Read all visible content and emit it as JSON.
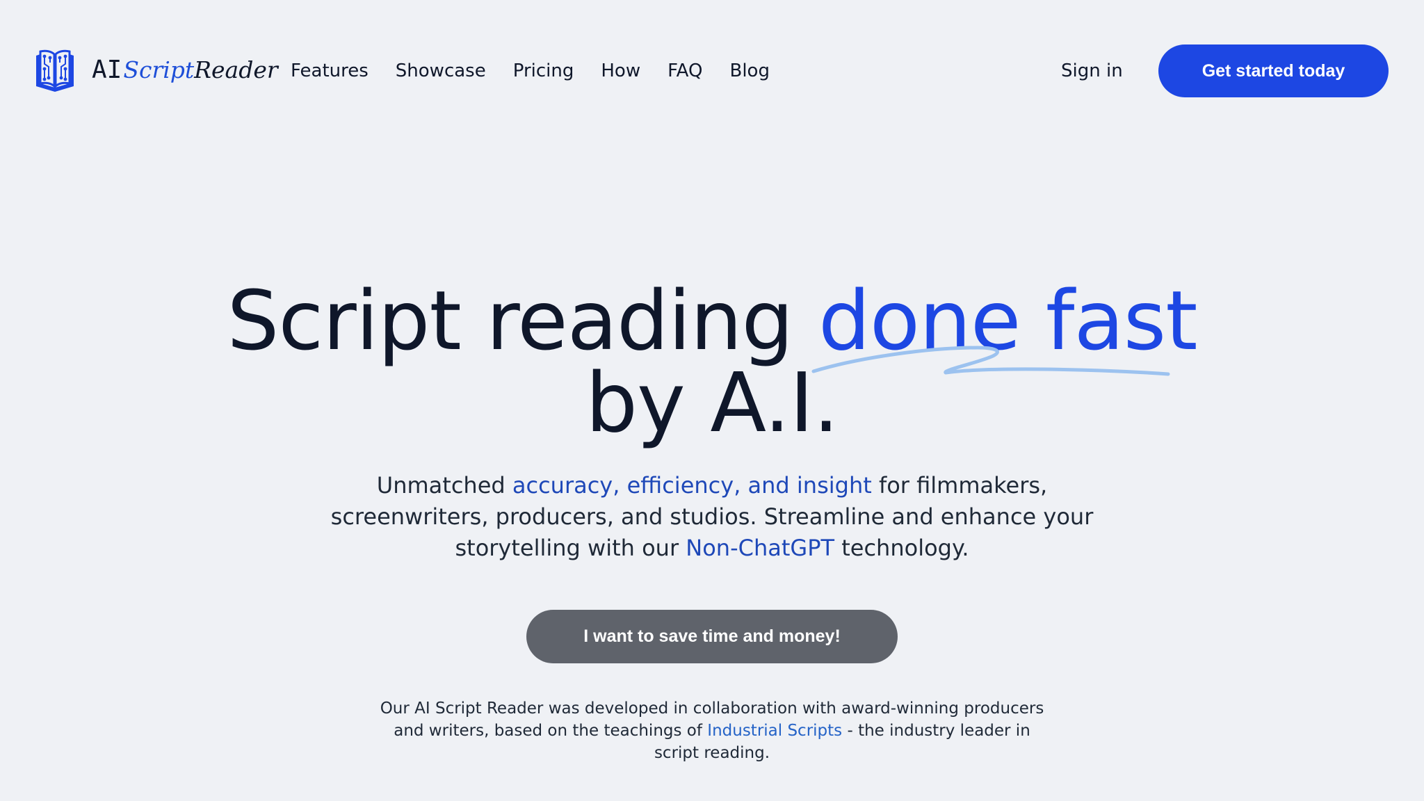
{
  "brand": {
    "logo_icon": "book-circuit-icon",
    "name_ai": "AI",
    "name_script": "Script",
    "name_reader": "Reader",
    "accent_color": "#1d47e3"
  },
  "nav": {
    "items": [
      {
        "label": "Features"
      },
      {
        "label": "Showcase"
      },
      {
        "label": "Pricing"
      },
      {
        "label": "How"
      },
      {
        "label": "FAQ"
      },
      {
        "label": "Blog"
      }
    ],
    "sign_in": "Sign in",
    "get_started": "Get started today"
  },
  "hero": {
    "title_part1": "Script reading ",
    "title_accent": "done fast",
    "title_line2": "by A.I.",
    "subtitle": {
      "pre": "Unmatched ",
      "highlight1": "accuracy, efficiency, and insight",
      "mid": " for filmmakers, screenwriters, producers, and studios. Streamline and enhance your storytelling with our ",
      "highlight2": "Non-ChatGPT",
      "post": " technology."
    },
    "cta": "I want to save time and money!",
    "note": {
      "pre": "Our AI Script Reader was developed in collaboration with award-winning producers and writers, based on the teachings of ",
      "link": "Industrial Scripts",
      "post": " - the industry leader in script reading."
    }
  }
}
